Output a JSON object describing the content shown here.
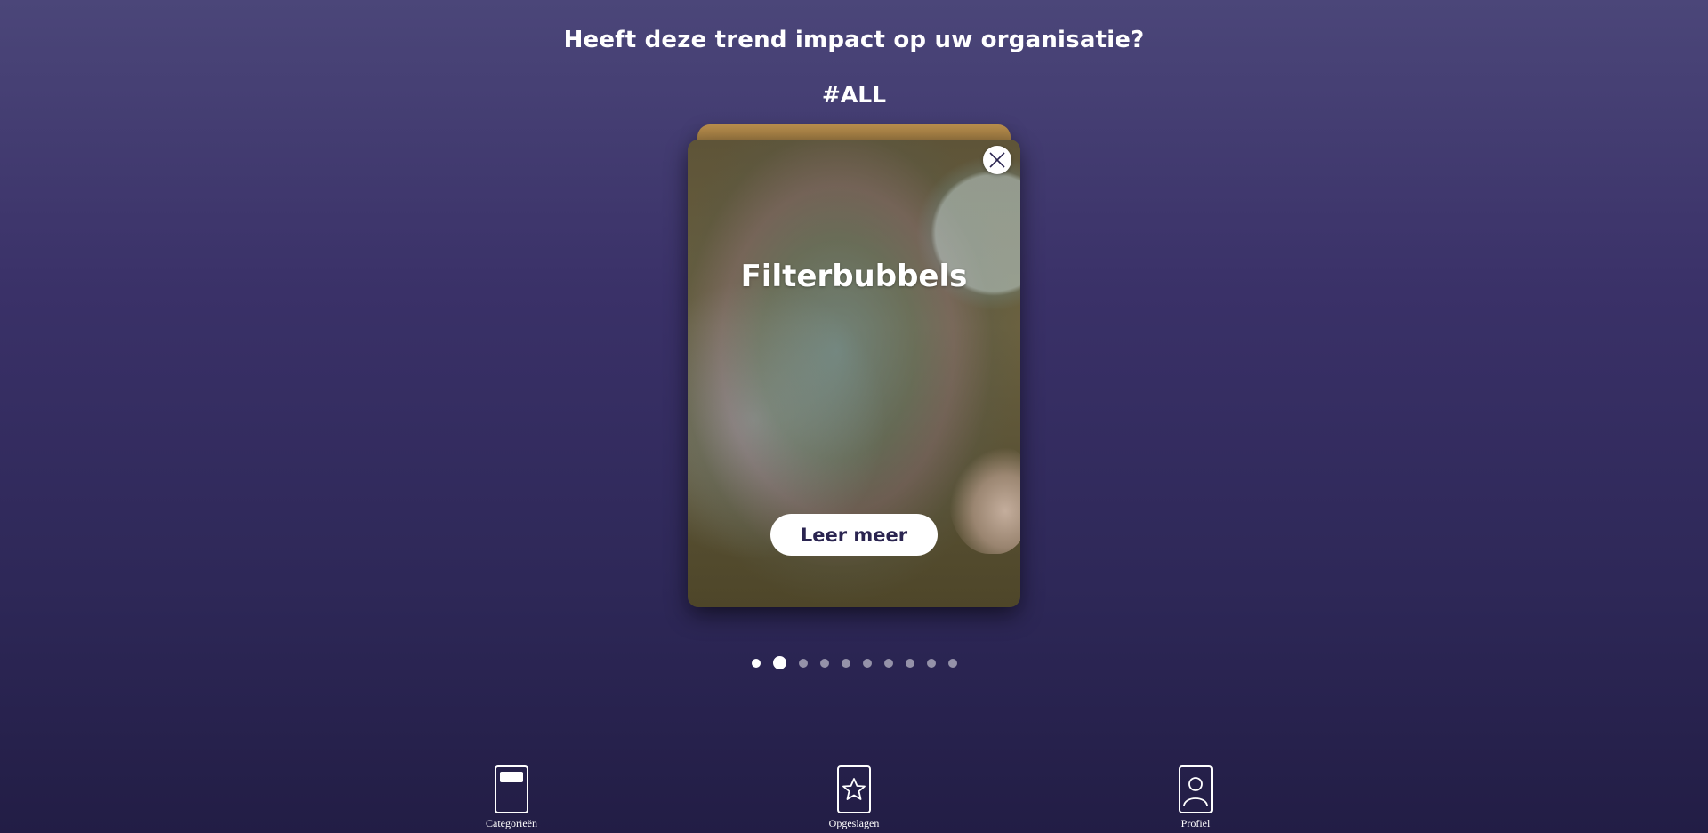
{
  "header": {
    "question": "Heeft deze trend impact op uw organisatie?",
    "hashtag": "#ALL"
  },
  "card": {
    "title": "Filterbubbels",
    "learn_more_label": "Leer meer",
    "close_icon": "close-icon"
  },
  "pagination": {
    "total": 10,
    "current": 2,
    "visited": [
      1
    ]
  },
  "nav": {
    "items": [
      {
        "label": "Categorieën",
        "icon": "categories-icon"
      },
      {
        "label": "Opgeslagen",
        "icon": "star-icon"
      },
      {
        "label": "Profiel",
        "icon": "profile-icon"
      }
    ]
  },
  "colors": {
    "background_top": "#4b4679",
    "background_bottom": "#221d45",
    "button_text": "#2a2450"
  }
}
